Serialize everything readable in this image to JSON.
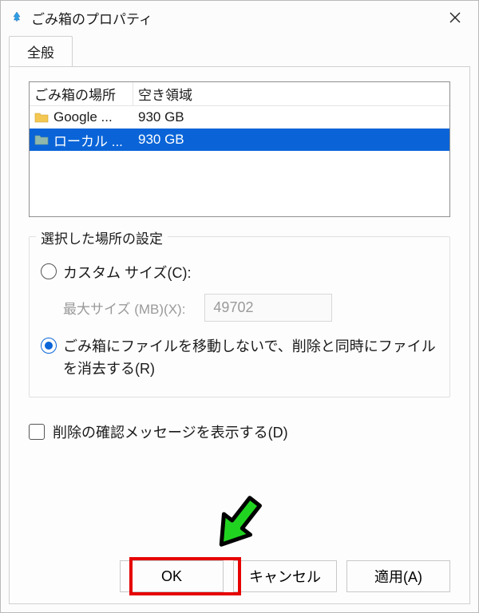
{
  "titlebar": {
    "title": "ごみ箱のプロパティ"
  },
  "tabs": {
    "general": "全般"
  },
  "list": {
    "header_location": "ごみ箱の場所",
    "header_space": "空き領域",
    "rows": [
      {
        "name": "Google ...",
        "space": "930 GB",
        "selected": false,
        "icon_color": "#f0c04a"
      },
      {
        "name": "ローカル ...",
        "space": "930 GB",
        "selected": true,
        "icon_color": "#7fa89e"
      }
    ]
  },
  "settings": {
    "legend": "選択した場所の設定",
    "custom_size_label": "カスタム サイズ(C):",
    "max_size_label": "最大サイズ (MB)(X):",
    "max_size_value": "49702",
    "delete_immediately_label": "ごみ箱にファイルを移動しないで、削除と同時にファイルを消去する(R)"
  },
  "confirm": {
    "label": "削除の確認メッセージを表示する(D)"
  },
  "buttons": {
    "ok": "OK",
    "cancel": "キャンセル",
    "apply": "適用(A)"
  }
}
